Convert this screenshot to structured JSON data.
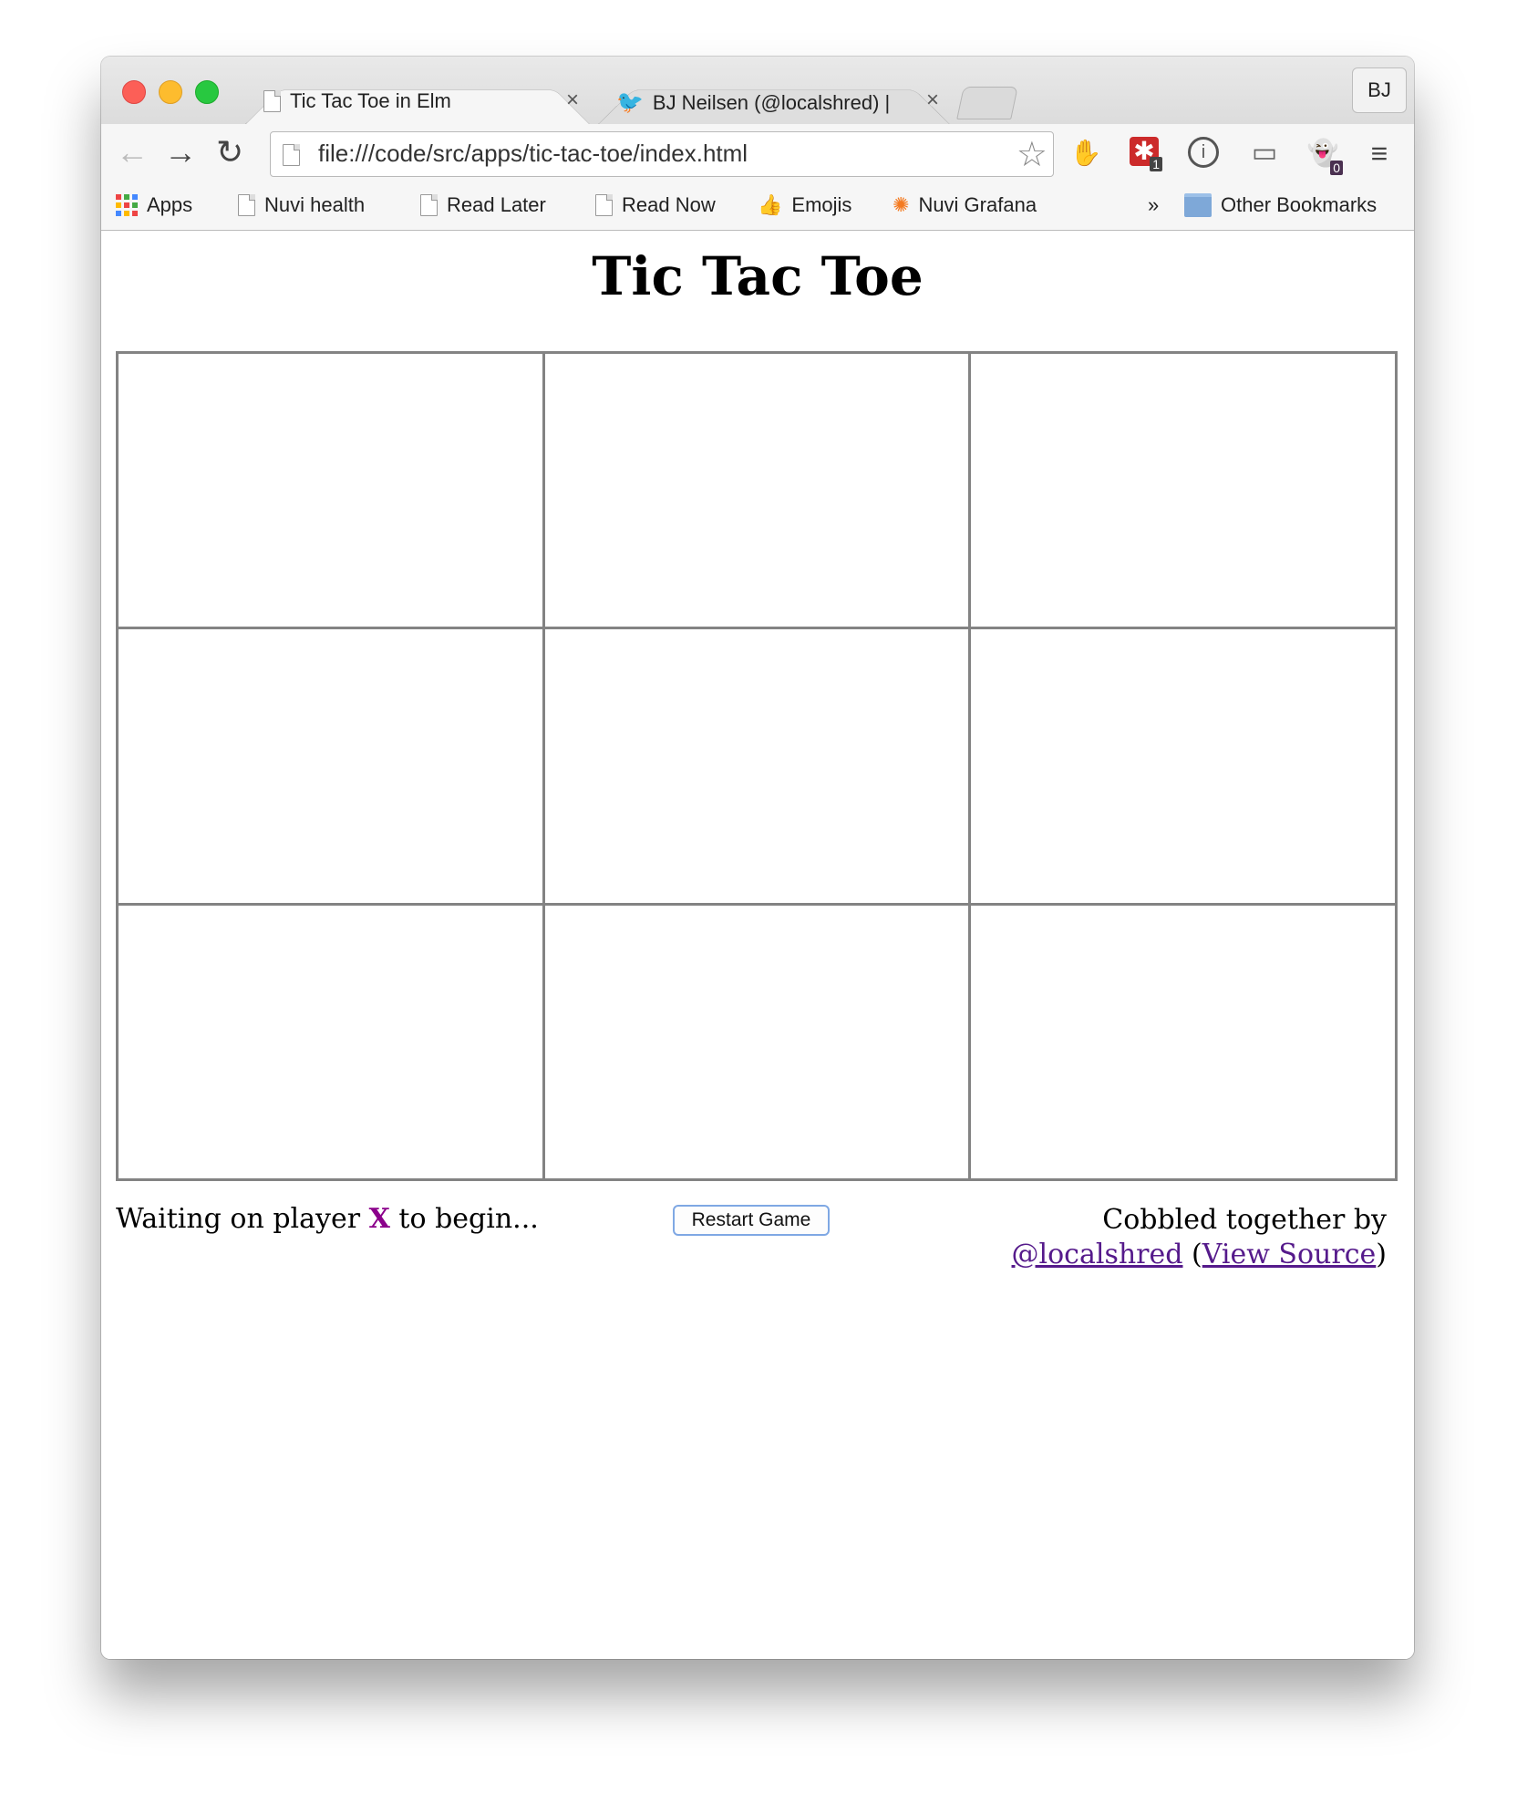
{
  "browser": {
    "tabs": [
      {
        "title": "Tic Tac Toe in Elm",
        "icon": "document-icon"
      },
      {
        "title": "BJ Neilsen (@localshred) |",
        "icon": "twitter-bird-icon"
      }
    ],
    "profile_label": "BJ",
    "url": "file:///code/src/apps/tic-tac-toe/index.html",
    "extension_badges": {
      "lastpass": "1",
      "ghostery": "0"
    },
    "bookmarks": [
      {
        "label": "Apps",
        "icon": "apps-grid-icon"
      },
      {
        "label": "Nuvi health",
        "icon": "document-icon"
      },
      {
        "label": "Read Later",
        "icon": "document-icon"
      },
      {
        "label": "Read Now",
        "icon": "document-icon"
      },
      {
        "label": "Emojis",
        "icon": "thumbs-up-icon"
      },
      {
        "label": "Nuvi Grafana",
        "icon": "grafana-icon"
      }
    ],
    "bookmarks_overflow": "»",
    "other_bookmarks": "Other Bookmarks"
  },
  "page": {
    "title": "Tic Tac Toe",
    "status_prefix": "Waiting on player ",
    "status_player": "X",
    "status_suffix": " to begin...",
    "player_color": "#8b008b",
    "restart_label": "Restart Game",
    "credit_line": "Cobbled together by",
    "credit_handle": "@localshred",
    "credit_open": " (",
    "credit_source": "View Source",
    "credit_close": ")"
  },
  "board": {
    "cells": [
      "",
      "",
      "",
      "",
      "",
      "",
      "",
      "",
      ""
    ]
  }
}
